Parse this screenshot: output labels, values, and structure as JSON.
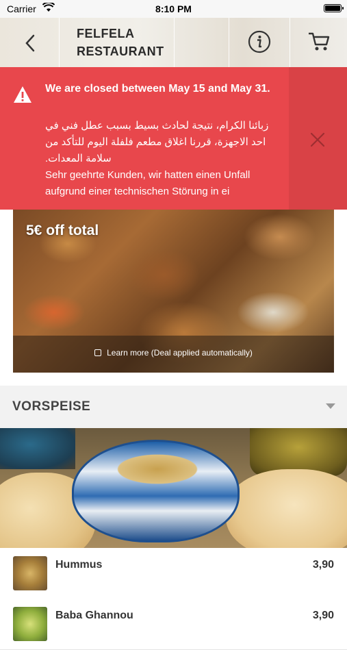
{
  "status_bar": {
    "carrier": "Carrier",
    "time": "8:10 PM"
  },
  "nav": {
    "title": "FELFELA RESTAURANT",
    "icons": [
      "chevron-left-icon",
      "info-icon",
      "cart-icon"
    ]
  },
  "alert": {
    "heading": "We are closed between May 15 and May 31.",
    "body_arabic": "زبائنا الكرام، نتيجة لحادث بسيط بسبب عطل فني في احد الاجهزة، قررنا اغلاق مطعم فلفلة اليوم للتأكد من سلامة المعدات.",
    "body_german": "Sehr geehrte Kunden, wir hatten einen Unfall aufgrund einer technischen Störung in ei",
    "color": "#e8474c"
  },
  "deal": {
    "offer": "5€ off total",
    "learn_more": "Learn more (Deal applied automatically)"
  },
  "category": {
    "title": "VORSPEISE"
  },
  "menu_items": [
    {
      "name": "Hummus",
      "price": "3,90"
    },
    {
      "name": "Baba Ghannou",
      "price": "3,90"
    }
  ]
}
